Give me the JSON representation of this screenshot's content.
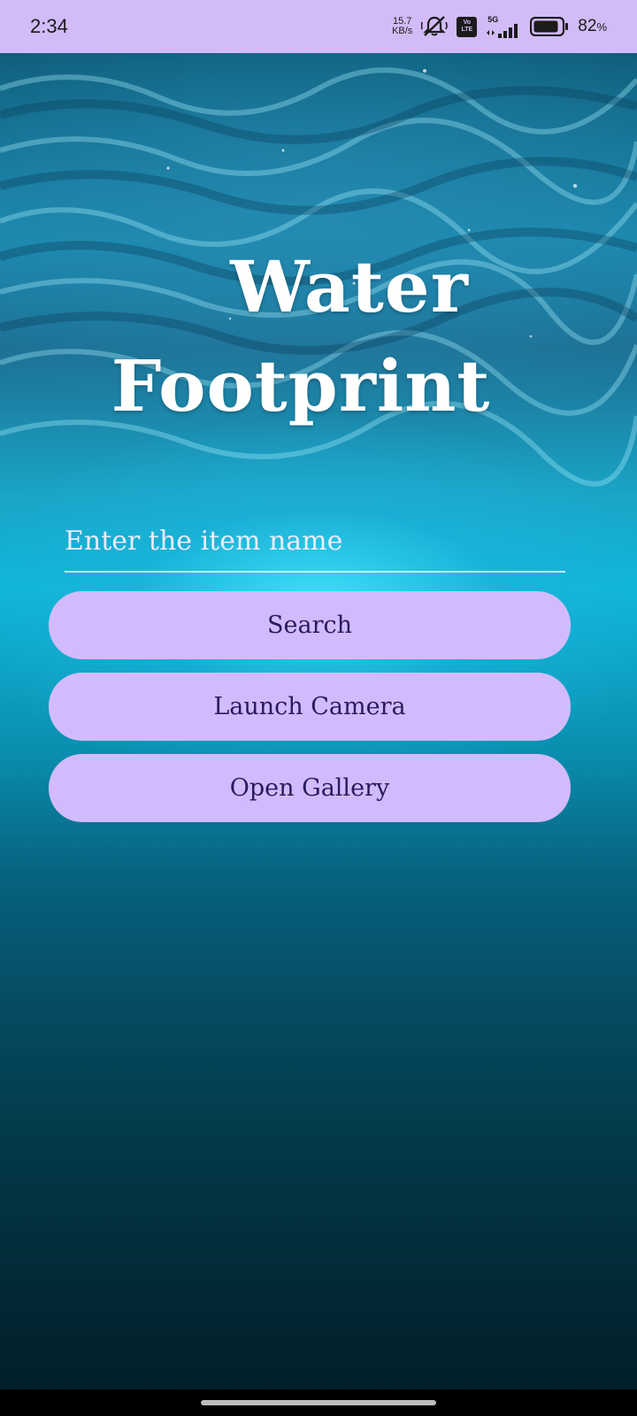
{
  "status_bar": {
    "time": "2:34",
    "net_speed_value": "15.7",
    "net_speed_unit": "KB/s",
    "volte_top": "Vo",
    "volte_bottom": "LTE",
    "network_type": "5G",
    "battery_value": "82",
    "battery_unit": "%"
  },
  "app": {
    "title_line1": "Water",
    "title_line2": "Footprint"
  },
  "search": {
    "placeholder": "Enter the item name",
    "value": ""
  },
  "buttons": {
    "search": "Search",
    "launch_camera": "Launch Camera",
    "open_gallery": "Open Gallery"
  },
  "icons": {
    "silent": "bell-off-icon",
    "signal": "signal-bars-icon",
    "battery": "battery-icon"
  },
  "colors": {
    "status_bar_bg": "#d2bbf6",
    "button_bg": "#d2bbfc",
    "button_text": "#2a1a5e"
  }
}
